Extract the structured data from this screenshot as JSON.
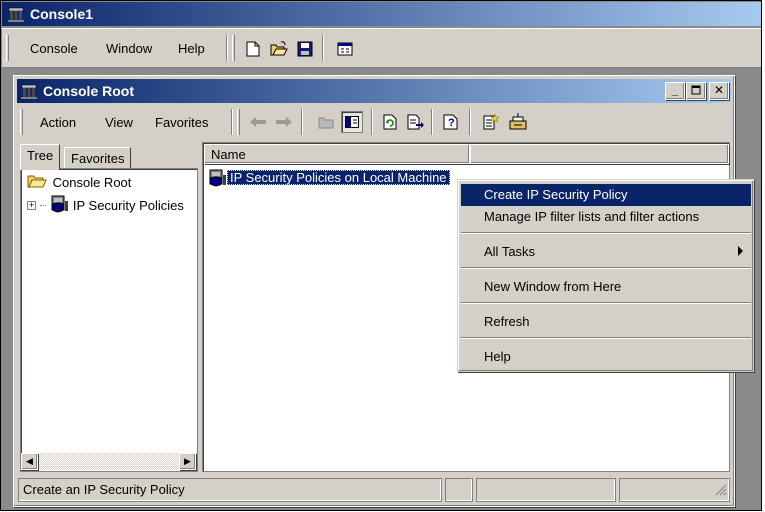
{
  "outer_window": {
    "title": "Console1",
    "menu": [
      "Console",
      "Window",
      "Help"
    ],
    "toolbar_icons": [
      "new-document-icon",
      "open-folder-icon",
      "save-icon",
      "properties-icon"
    ]
  },
  "inner_window": {
    "title": "Console Root",
    "window_controls": [
      "minimize-icon",
      "restore-icon",
      "close-icon"
    ],
    "menu": [
      "Action",
      "View",
      "Favorites"
    ],
    "toolbar_icons": [
      "back-arrow-icon",
      "forward-arrow-icon",
      "up-level-icon",
      "show-hide-tree-icon",
      "refresh-icon",
      "export-list-icon",
      "help-icon",
      "create-policy-icon",
      "manage-filters-icon"
    ]
  },
  "tabs": [
    "Tree",
    "Favorites"
  ],
  "tree": {
    "root": "Console Root",
    "child": "IP Security Policies"
  },
  "list": {
    "column_header": "Name",
    "items": [
      "IP Security Policies on Local Machine"
    ]
  },
  "context_menu": {
    "items": [
      {
        "label": "Create IP Security Policy",
        "selected": true
      },
      {
        "label": "Manage IP filter lists and filter actions"
      },
      {
        "label": "All Tasks",
        "submenu": true
      },
      {
        "label": "New Window from Here"
      },
      {
        "label": "Refresh"
      },
      {
        "label": "Help"
      }
    ]
  },
  "status_bar": {
    "text": "Create an IP Security Policy"
  },
  "colors": {
    "titlebar_start": "#0a246a",
    "titlebar_end": "#a6caf0",
    "selection": "#0a246a",
    "face": "#d4d0c8"
  }
}
